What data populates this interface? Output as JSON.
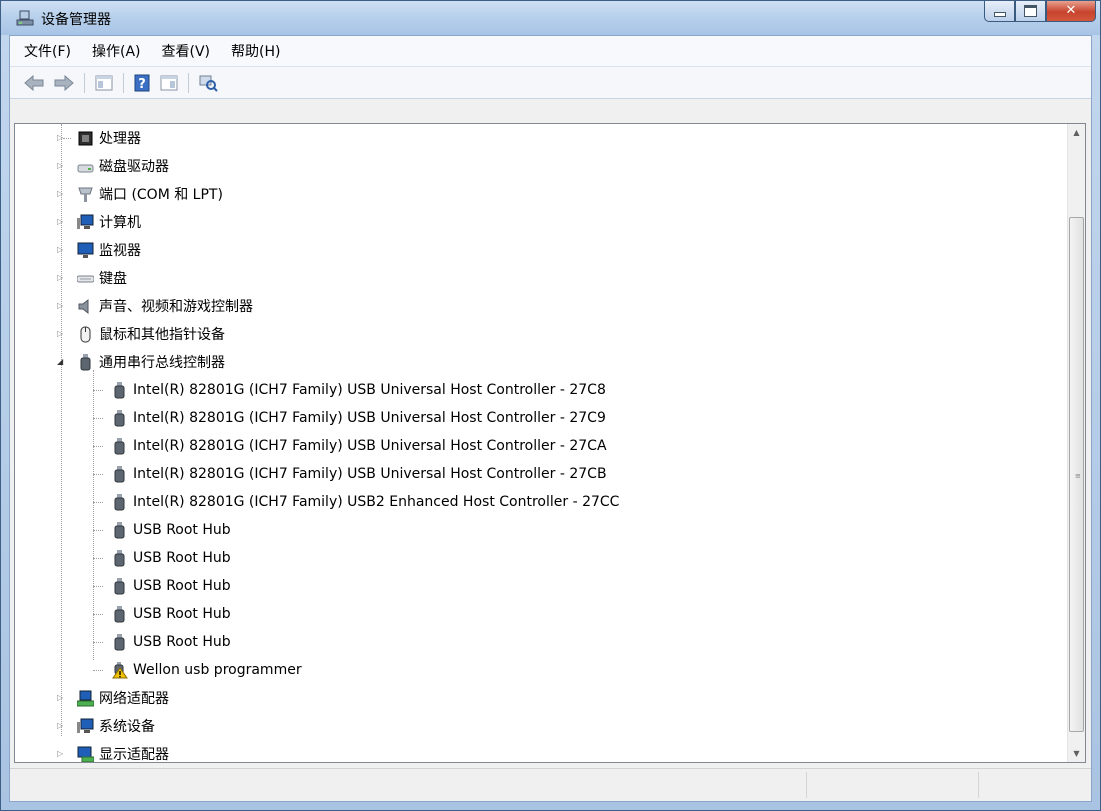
{
  "window": {
    "title": "设备管理器"
  },
  "menu": [
    {
      "label": "文件(F)"
    },
    {
      "label": "操作(A)"
    },
    {
      "label": "查看(V)"
    },
    {
      "label": "帮助(H)"
    }
  ],
  "toolbar": [
    "back-arrow-icon",
    "forward-arrow-icon",
    "show-hide-tree-icon",
    "help-icon",
    "properties-icon",
    "scan-hardware-icon"
  ],
  "tree": {
    "categories_top": [
      {
        "label": "处理器",
        "icon": "processor-icon"
      },
      {
        "label": "磁盘驱动器",
        "icon": "disk-drive-icon"
      },
      {
        "label": "端口 (COM 和 LPT)",
        "icon": "port-icon"
      },
      {
        "label": "计算机",
        "icon": "computer-icon"
      },
      {
        "label": "监视器",
        "icon": "monitor-icon"
      },
      {
        "label": "键盘",
        "icon": "keyboard-icon"
      },
      {
        "label": "声音、视频和游戏控制器",
        "icon": "speaker-icon"
      },
      {
        "label": "鼠标和其他指针设备",
        "icon": "mouse-icon"
      }
    ],
    "expanded": {
      "label": "通用串行总线控制器",
      "icon": "usb-icon",
      "children": [
        {
          "label": "Intel(R) 82801G (ICH7 Family) USB Universal Host Controller - 27C8",
          "icon": "usb-device-icon"
        },
        {
          "label": "Intel(R) 82801G (ICH7 Family) USB Universal Host Controller - 27C9",
          "icon": "usb-device-icon"
        },
        {
          "label": "Intel(R) 82801G (ICH7 Family) USB Universal Host Controller - 27CA",
          "icon": "usb-device-icon"
        },
        {
          "label": "Intel(R) 82801G (ICH7 Family) USB Universal Host Controller - 27CB",
          "icon": "usb-device-icon"
        },
        {
          "label": "Intel(R) 82801G (ICH7 Family) USB2 Enhanced Host Controller - 27CC",
          "icon": "usb-device-icon"
        },
        {
          "label": "USB Root Hub",
          "icon": "usb-device-icon"
        },
        {
          "label": "USB Root Hub",
          "icon": "usb-device-icon"
        },
        {
          "label": "USB Root Hub",
          "icon": "usb-device-icon"
        },
        {
          "label": "USB Root Hub",
          "icon": "usb-device-icon"
        },
        {
          "label": "USB Root Hub",
          "icon": "usb-device-icon"
        },
        {
          "label": "Wellon usb programmer",
          "icon": "usb-warning-icon"
        }
      ]
    },
    "categories_bottom": [
      {
        "label": "网络适配器",
        "icon": "network-adapter-icon"
      },
      {
        "label": "系统设备",
        "icon": "system-device-icon"
      },
      {
        "label": "显示适配器",
        "icon": "display-adapter-icon"
      }
    ]
  },
  "colors": {
    "accent": "#3d6fb0",
    "warning": "#f2c200"
  }
}
